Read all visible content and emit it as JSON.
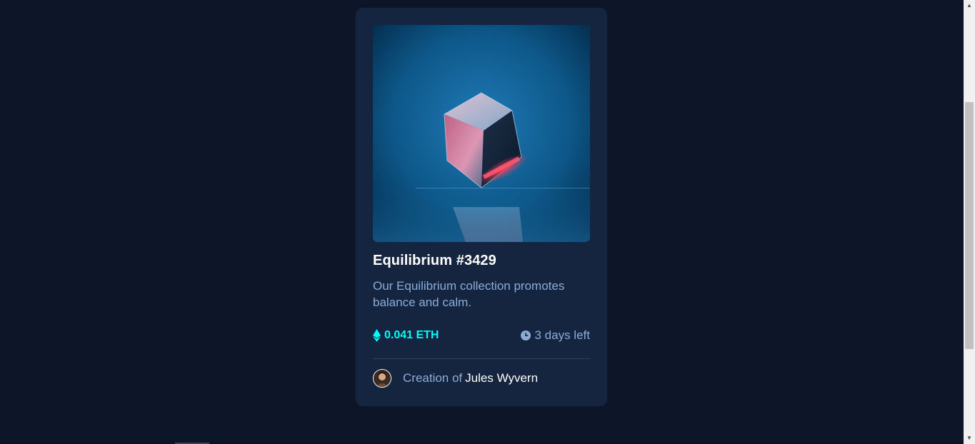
{
  "card": {
    "image_alt": "equilibrium",
    "title": "Equilibrium #3429",
    "description": "Our Equilibrium collection promotes balance and calm.",
    "price": "0.041 ETH",
    "time_left": "3 days left",
    "creator_prefix": "Creation of",
    "creator_name": "Jules Wyvern"
  },
  "colors": {
    "page_bg": "#0d1628",
    "card_bg": "#15253f",
    "accent_cyan": "#00fff8",
    "soft_blue": "#8bacd9",
    "white": "#ffffff",
    "divider": "#2e405a"
  },
  "icons": {
    "price": "ethereum-icon",
    "time": "clock-icon"
  }
}
